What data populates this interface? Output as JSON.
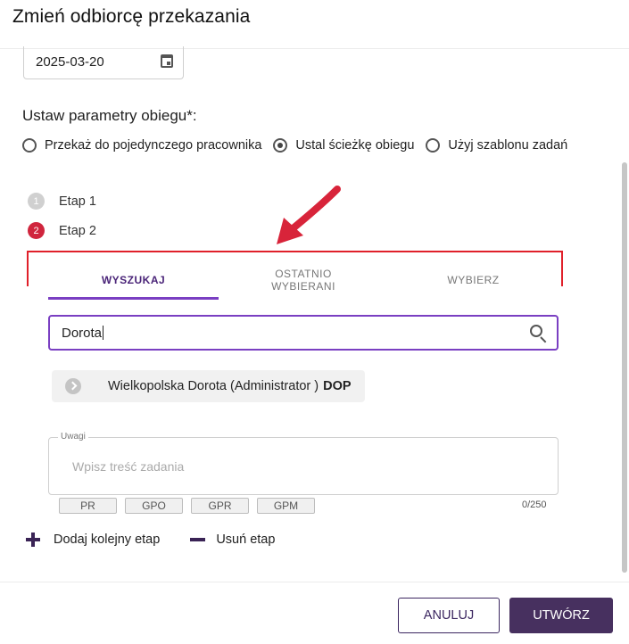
{
  "dialog": {
    "title": "Zmień odbiorcę przekazania"
  },
  "date_field": {
    "value": "2025-03-20",
    "icon": "calendar-icon"
  },
  "routing": {
    "label": "Ustaw parametry obiegu*:",
    "options": [
      {
        "label": "Przekaż do pojedynczego pracownika",
        "selected": false
      },
      {
        "label": "Ustal ścieżkę obiegu",
        "selected": true
      },
      {
        "label": "Użyj szablonu zadań",
        "selected": false
      }
    ]
  },
  "steps": [
    {
      "number": "1",
      "label": "Etap 1",
      "active": false
    },
    {
      "number": "2",
      "label": "Etap 2",
      "active": true
    }
  ],
  "tabs": [
    {
      "label": "WYSZUKAJ",
      "active": true
    },
    {
      "label": "OSTATNIO WYBIERANI",
      "active": false
    },
    {
      "label": "WYBIERZ",
      "active": false
    }
  ],
  "search": {
    "value": "Dorota",
    "icon": "search-icon"
  },
  "result": {
    "name": "Wielkopolska Dorota (Administrator )",
    "code": "DOP"
  },
  "notes": {
    "label": "Uwagi",
    "placeholder": "Wpisz treść zadania",
    "counter": "0/250",
    "chips": [
      "PR",
      "GPO",
      "GPR",
      "GPM"
    ]
  },
  "stage_actions": {
    "add_label": "Dodaj kolejny etap",
    "remove_label": "Usuń etap"
  },
  "footer": {
    "cancel_label": "ANULUJ",
    "create_label": "UTWÓRZ"
  },
  "colors": {
    "accent": "#7a3fc2",
    "primary_button": "#47305f",
    "step_active": "#d0253d",
    "annotation": "#e0202a"
  }
}
